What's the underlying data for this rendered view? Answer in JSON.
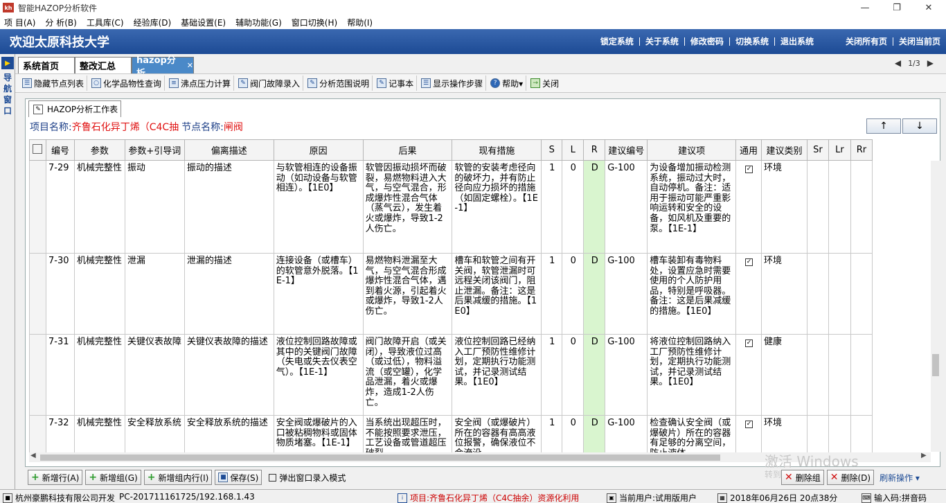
{
  "window": {
    "title": "智能HAZOP分析软件",
    "app_icon": "kh"
  },
  "menu": [
    "项 目(A)",
    "分 析(B)",
    "工具库(C)",
    "经验库(D)",
    "基础设置(E)",
    "辅助功能(G)",
    "窗口切换(H)",
    "帮助(I)"
  ],
  "header": {
    "title": "欢迎太原科技大学",
    "links": [
      "锁定系统",
      "关于系统",
      "修改密码",
      "切换系统",
      "退出系统"
    ],
    "links_right": [
      "关闭所有页",
      "关闭当前页"
    ]
  },
  "nav": {
    "label": "导航窗口"
  },
  "tabs": [
    {
      "label": "系统首页"
    },
    {
      "label": "整改汇总"
    },
    {
      "label": "hazop分析",
      "active": true
    }
  ],
  "pager": {
    "text": "1/3"
  },
  "toolbar": [
    "隐藏节点列表",
    "化学品物性查询",
    "沸点压力计算",
    "阀门故障录入",
    "分析范围说明",
    "记事本",
    "显示操作步骤",
    "帮助▾",
    "关闭"
  ],
  "worktab": {
    "label": "HAZOP分析工作表"
  },
  "info": {
    "project_label": "项目名称:",
    "project_value": "齐鲁石化异丁烯（C4C抽",
    "node_label": "节点名称:",
    "node_value": "闸阀"
  },
  "sort": {
    "up": "↑",
    "down": "↓"
  },
  "table": {
    "headers": [
      "编号",
      "参数",
      "参数+引导词",
      "偏离描述",
      "原因",
      "后果",
      "现有措施",
      "S",
      "L",
      "R",
      "建议编号",
      "建议项",
      "通用",
      "建议类别",
      "Sr",
      "Lr",
      "Rr"
    ],
    "rows": [
      {
        "id": "7-29",
        "param": "机械完整性",
        "guide": "振动",
        "dev": "振动的描述",
        "cause": "与软管相连的设备振动（如动设备与软管相连）。【1E0】",
        "cons": "软管因振动损坏而破裂，易燃物料进入大气，与空气混合，形成爆炸性混合气体（蒸气云），发生着火或爆炸，导致1-2人伤亡。",
        "meas": "软管的安装考虑径向的破坏力，并有防止径向应力损坏的措施（如固定螺栓）。【1E-1】",
        "S": "1",
        "L": "0",
        "R": "D",
        "sno": "G-100",
        "sug": "为设备增加振动检测系统，振动过大时，自动停机。备注：适用于振动可能严重影响运转和安全的设备，如风机及重要的泵。【1E-1】",
        "gen": "✓",
        "cat": "环境"
      },
      {
        "id": "7-30",
        "param": "机械完整性",
        "guide": "泄漏",
        "dev": "泄漏的描述",
        "cause": "连接设备（或槽车）的软管意外脱落。【1E-1】",
        "cons": "易燃物料泄漏至大气，与空气混合形成爆炸性混合气体，遇到着火源，引起着火或爆炸，导致1-2人伤亡。",
        "meas": "槽车和软管之间有开关阀，软管泄漏时可远程关闭该阀门，阻止泄漏。备注：这是后果减缓的措施。【1E0】",
        "S": "1",
        "L": "0",
        "R": "D",
        "sno": "G-100",
        "sug": "槽车装卸有毒物料处，设置应急时需要使用的个人防护用品，特别是呼吸器。备注：这是后果减缓的措施。【1E0】",
        "gen": "✓",
        "cat": "环境"
      },
      {
        "id": "7-31",
        "param": "机械完整性",
        "guide": "关键仪表故障",
        "dev": "关键仪表故障的描述",
        "cause": "液位控制回路故障或其中的关键阀门故障（失电或失去仪表空气）。【1E-1】",
        "cons": "阀门故障开启（或关闭），导致液位过高（或过低），物料溢流（或空罐），化学品泄漏，着火或爆炸，造成1-2人伤亡。",
        "meas": "液位控制回路已经纳入工厂预防性维修计划，定期执行功能测试，并记录测试结果。【1E0】",
        "S": "1",
        "L": "0",
        "R": "D",
        "sno": "G-100",
        "sug": "将液位控制回路纳入工厂预防性维修计划，定期执行功能测试，并记录测试结果。【1E0】",
        "gen": "✓",
        "cat": "健康"
      },
      {
        "id": "7-32",
        "param": "机械完整性",
        "guide": "安全释放系统",
        "dev": "安全释放系统的描述",
        "cause": "安全阀或爆破片的入口被粘稠物料或固体物质堵塞。【1E-1】",
        "cons": "当系统出现超压时，不能按照要求泄压，工艺设备或管道超压破裂",
        "meas": "安全阀（或爆破片）所在的容器有高高液位报警，确保液位不会淹没",
        "S": "1",
        "L": "0",
        "R": "D",
        "sno": "G-100",
        "sug": "检查确认安全阀（或爆破片）所在的容器有足够的分离空间，防止液体",
        "gen": "✓",
        "cat": "环境"
      }
    ]
  },
  "buttons": [
    "新增行(A)",
    "新增组(G)",
    "新增组内行(I)",
    "保存(S)"
  ],
  "popup_checkbox": "弹出窗口录入模式",
  "buttons_right": [
    "删除组",
    "删除(D)",
    "刷新操作"
  ],
  "watermark": "激活 Windows",
  "watermark_sub": "转到",
  "status": {
    "company": "杭州豪鹏科技有限公司开发",
    "host": "PC-201711161725/192.168.1.43",
    "project": "项目:齐鲁石化异丁烯（C4C抽余）资源化利用",
    "user": "当前用户:试用版用户",
    "date": "2018年06月26日 20点38分",
    "ime": "输入码:拼音码"
  }
}
